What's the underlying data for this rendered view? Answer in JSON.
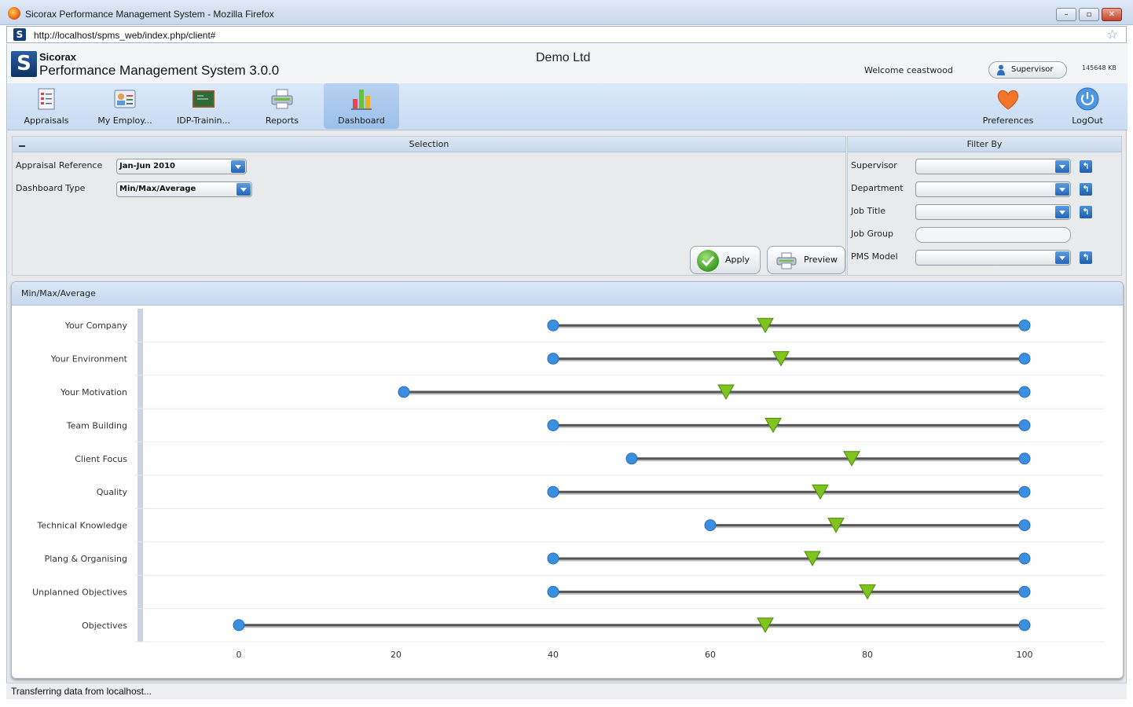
{
  "window": {
    "title": "Sicorax Performance Management System - Mozilla Firefox",
    "url": "http://localhost/spms_web/index.php/client#"
  },
  "header": {
    "brand": "Sicorax",
    "product": "Performance Management System 3.0.0",
    "company": "Demo Ltd",
    "welcome": "Welcome ceastwood",
    "role": "Supervisor",
    "memory": "145648 KB"
  },
  "toolbar": {
    "items": [
      {
        "label": "Appraisals",
        "icon": "appraisals-icon"
      },
      {
        "label": "My Employ...",
        "icon": "employees-icon"
      },
      {
        "label": "IDP-Trainin...",
        "icon": "training-board-icon"
      },
      {
        "label": "Reports",
        "icon": "printer-icon"
      },
      {
        "label": "Dashboard",
        "icon": "bar-chart-icon",
        "active": true
      }
    ],
    "right_items": [
      {
        "label": "Preferences",
        "icon": "heart-icon"
      },
      {
        "label": "LogOut",
        "icon": "power-icon"
      }
    ]
  },
  "selection": {
    "title": "Selection",
    "appraisal_reference_label": "Appraisal Reference",
    "appraisal_reference_value": "Jan-Jun 2010",
    "dashboard_type_label": "Dashboard Type",
    "dashboard_type_value": "Min/Max/Average",
    "apply_label": "Apply",
    "preview_label": "Preview"
  },
  "filter": {
    "title": "Filter By",
    "supervisor_label": "Supervisor",
    "department_label": "Department",
    "job_title_label": "Job Title",
    "job_group_label": "Job Group",
    "pms_model_label": "PMS Model"
  },
  "chart_panel": {
    "title": "Min/Max/Average"
  },
  "status": "Transferring data from localhost...",
  "colors": {
    "min_max_marker": "#3a8fe0",
    "average_marker": "#7fc31c",
    "range_line": "#555555"
  },
  "chart_data": {
    "type": "range",
    "categories": [
      "Your Company",
      "Your Environment",
      "Your Motivation",
      "Team Building",
      "Client Focus",
      "Quality",
      "Technical Knowledge",
      "Plang & Organising",
      "Unplanned Objectives",
      "Objectives"
    ],
    "series": [
      {
        "values": [
          40,
          40,
          21,
          40,
          50,
          40,
          60,
          40,
          40,
          0
        ]
      },
      {
        "values": [
          67,
          69,
          62,
          68,
          78,
          74,
          76,
          73,
          80,
          67
        ]
      },
      {
        "values": [
          100,
          100,
          100,
          100,
          100,
          100,
          100,
          100,
          100,
          100
        ]
      }
    ],
    "xlim": [
      -13,
      110
    ],
    "x_ticks": [
      0,
      20,
      40,
      60,
      80,
      100
    ]
  }
}
